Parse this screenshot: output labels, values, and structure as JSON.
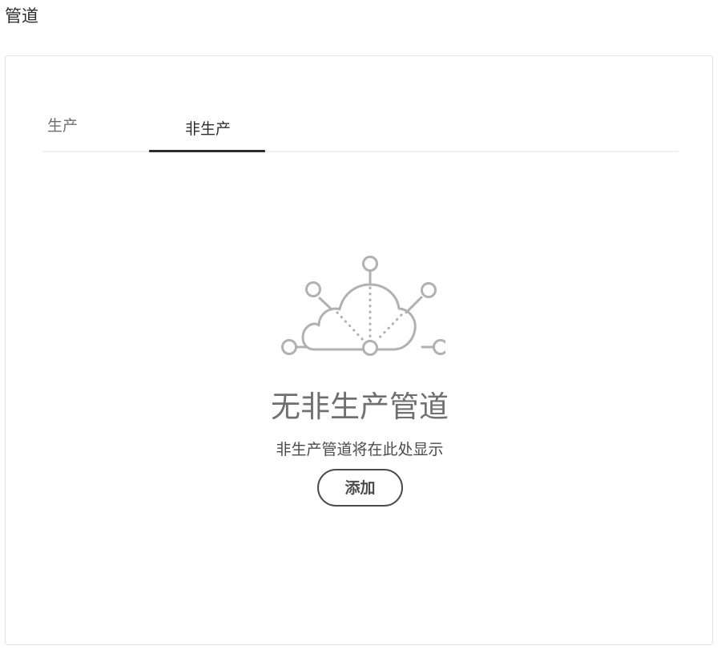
{
  "page": {
    "title": "管道"
  },
  "tabs": [
    {
      "label": "生产",
      "selected": false
    },
    {
      "label": "非生产",
      "selected": true
    }
  ],
  "empty_state": {
    "illustration_icon": "cloud-network-icon",
    "heading": "无非生产管道",
    "description": "非生产管道将在此处显示",
    "add_button_label": "添加"
  },
  "colors": {
    "text_primary": "#2c2c2c",
    "text_muted": "#6e6e6e",
    "heading_gray": "#707070",
    "illustration_gray": "#b1b1b1",
    "border": "#e1e1e1",
    "tab_indicator": "#2c2c2c"
  }
}
